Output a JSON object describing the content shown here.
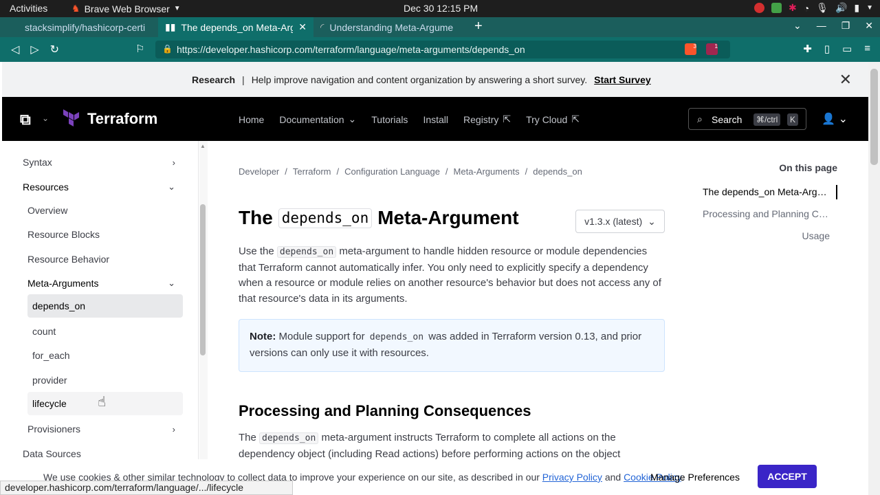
{
  "os": {
    "activities": "Activities",
    "app_name": "Brave Web Browser",
    "clock": "Dec 30  12:15 PM"
  },
  "browser": {
    "tabs": [
      {
        "label": "stacksimplify/hashicorp-certi"
      },
      {
        "label": "The depends_on Meta-Arg"
      },
      {
        "label": "Understanding Meta-Argume"
      }
    ],
    "url": "https://developer.hashicorp.com/terraform/language/meta-arguments/depends_on",
    "shield_count": "3",
    "alert_count": "1",
    "status_url": "developer.hashicorp.com/terraform/language/.../lifecycle"
  },
  "banner": {
    "label": "Research",
    "separator": "|",
    "message": "Help improve navigation and content organization by answering a short survey.",
    "cta": "Start Survey"
  },
  "nav": {
    "product": "Terraform",
    "links": [
      "Home",
      "Documentation",
      "Tutorials",
      "Install",
      "Registry",
      "Try Cloud"
    ],
    "search_label": "Search",
    "search_kbd_mod": "⌘/ctrl",
    "search_kbd_key": "K"
  },
  "sidebar": {
    "items": [
      {
        "label": "Syntax"
      },
      {
        "label": "Resources"
      },
      {
        "label": "Overview"
      },
      {
        "label": "Resource Blocks"
      },
      {
        "label": "Resource Behavior"
      },
      {
        "label": "Meta-Arguments"
      },
      {
        "label": "depends_on"
      },
      {
        "label": "count"
      },
      {
        "label": "for_each"
      },
      {
        "label": "provider"
      },
      {
        "label": "lifecycle"
      },
      {
        "label": "Provisioners"
      },
      {
        "label": "Data Sources"
      }
    ]
  },
  "breadcrumb": [
    "Developer",
    "Terraform",
    "Configuration Language",
    "Meta-Arguments",
    "depends_on"
  ],
  "breadcrumb_sep": "/",
  "article": {
    "title_pre": "The",
    "title_code": "depends_on",
    "title_post": "Meta-Argument",
    "version": "v1.3.x (latest)",
    "p1_pre": "Use the",
    "p1_code": "depends_on",
    "p1_post": "meta-argument to handle hidden resource or module dependencies that Terraform cannot automatically infer. You only need to explicitly specify a dependency when a resource or module relies on another resource's behavior but does not access any of that resource's data in its arguments.",
    "note_label": "Note:",
    "note_pre": "Module support for",
    "note_code": "depends_on",
    "note_post": "was added in Terraform version 0.13, and prior versions can only use it with resources.",
    "h2": "Processing and Planning Consequences",
    "p2_pre": "The",
    "p2_code": "depends_on",
    "p2_post": "meta-argument instructs Terraform to complete all actions on the dependency object (including Read actions) before performing actions on the object"
  },
  "on_this_page": {
    "title": "On this page",
    "items": [
      "The depends_on Meta-Argu...",
      "Processing and Planning Co...",
      "Usage"
    ]
  },
  "cookie": {
    "text_pre": "We use cookies & other similar technology to collect data to improve your experience on our site, as described in our",
    "privacy": "Privacy Policy",
    "and": "and",
    "cookie_policy": "Cookie Policy",
    "dot": ".",
    "manage": "Manage Preferences",
    "accept": "ACCEPT"
  },
  "colors": {
    "brand_terraform": "#7b42bc",
    "accept_button": "#3a25c7",
    "tab_strip": "#1b5e5c"
  }
}
